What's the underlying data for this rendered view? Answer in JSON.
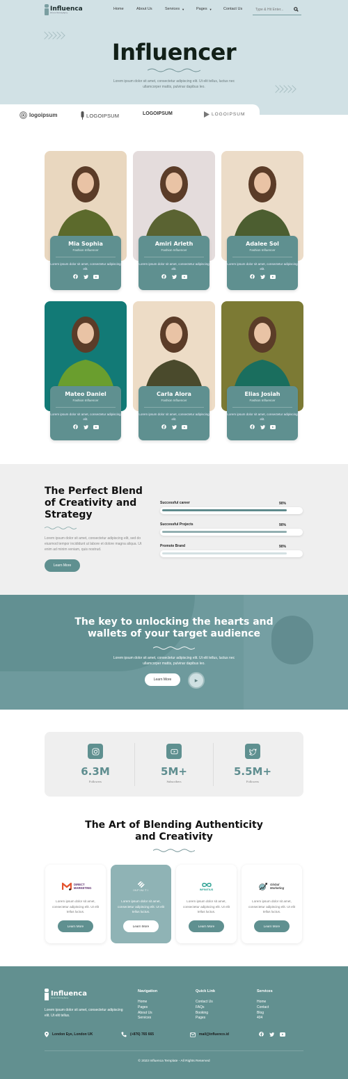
{
  "nav": {
    "logo_text": "Influenca",
    "logo_subtitle": "Influencer Marketing Agency",
    "items": [
      {
        "label": "Home",
        "has_dropdown": false
      },
      {
        "label": "About Us",
        "has_dropdown": false
      },
      {
        "label": "Services",
        "has_dropdown": true
      },
      {
        "label": "Pages",
        "has_dropdown": true
      },
      {
        "label": "Contact Us",
        "has_dropdown": false
      }
    ],
    "search_placeholder": "Type & Hit Enter...",
    "search_icon": "search-icon"
  },
  "hero": {
    "title": "Influencer",
    "description": "Lorem ipsum dolor sit amet, consectetur adipiscing elit. Ut elit tellus, luctus nec ullamcorper mattis, pulvinar dapibus leo."
  },
  "partner_logos": [
    "logoipsum",
    "LOGOIPSUM",
    "LOGOIPSUM",
    "LOGOIPSUM"
  ],
  "influencers": [
    {
      "name": "Mia Sophia",
      "role": "Fashion Influencer",
      "desc": "Lorem ipsum dolor sit amet, consectetur adipiscing elit.",
      "photo_colors": [
        "#e9d7bf",
        "#5c6a2c"
      ]
    },
    {
      "name": "Amiri Arleth",
      "role": "Fashion Influencer",
      "desc": "Lorem ipsum dolor sit amet, consectetur adipiscing elit.",
      "photo_colors": [
        "#e4dcdc",
        "#5a6332"
      ]
    },
    {
      "name": "Adalee Sol",
      "role": "Fashion Influencer",
      "desc": "Lorem ipsum dolor sit amet, consectetur adipiscing elit.",
      "photo_colors": [
        "#ecdcc8",
        "#4c5e30"
      ]
    },
    {
      "name": "Mateo Daniel",
      "role": "Fashion Influencer",
      "desc": "Lorem ipsum dolor sit amet, consectetur adipiscing elit.",
      "photo_colors": [
        "#127a76",
        "#6a9e2e"
      ]
    },
    {
      "name": "Carla Alora",
      "role": "Fashion Influencer",
      "desc": "Lorem ipsum dolor sit amet, consectetur adipiscing elit.",
      "photo_colors": [
        "#eddcc6",
        "#4a4a2c"
      ]
    },
    {
      "name": "Elias Josiah",
      "role": "Fashion Influencer",
      "desc": "Lorem ipsum dolor sit amet, consectetur adipiscing elit.",
      "photo_colors": [
        "#7c7a34",
        "#1a6e5e"
      ]
    }
  ],
  "blend": {
    "title": "The Perfect Blend of Creativity and Strategy",
    "description": "Lorem ipsum dolor sit amet, consectetur adipiscing elit, sed do eiusmod tempor incididunt ut labore et dolore magna aliqua. Ut enim ad minim veniam, quis nostrud.",
    "button": "Learn More",
    "skills": [
      {
        "label": "Successful career",
        "value": 90,
        "value_label": "90%",
        "color": "#5f8a8c"
      },
      {
        "label": "Successful Projects",
        "value": 90,
        "value_label": "90%",
        "color": "#92afb1"
      },
      {
        "label": "Promote Brand",
        "value": 90,
        "value_label": "90%",
        "color": "#d3e0e2"
      }
    ]
  },
  "cta": {
    "title": "The key to unlocking the hearts and wallets of your target audience",
    "description": "Lorem ipsum dolor sit amet, consectetur adipiscing elit. Ut elit tellus, luctus nec ullamcorper mattis, pulvinar dapibus leo.",
    "button": "Learn More",
    "play_icon": "play-icon"
  },
  "stats": [
    {
      "icon": "instagram-icon",
      "value": "6.3M",
      "label": "Followers"
    },
    {
      "icon": "youtube-icon",
      "value": "5M+",
      "label": "Subscribers"
    },
    {
      "icon": "twitter-icon",
      "value": "5.5M+",
      "label": "Followers"
    }
  ],
  "art": {
    "title": "The Art of Blending Authenticity and Creativity",
    "partners": [
      {
        "logo": "DIRECT MARKETING",
        "desc": "Lorem ipsum dolor sit amet, consectetur adipiscing elit. Ut elit tellus luctus.",
        "button": "Learn More",
        "active": false
      },
      {
        "logo": "INFINITI",
        "desc": "Lorem ipsum dolor sit amet, consectetur adipiscing elit. Ut elit tellus luctus.",
        "button": "Learn More",
        "active": true
      },
      {
        "logo": "INFINITIUS",
        "desc": "Lorem ipsum dolor sit amet, consectetur adipiscing elit. Ut elit tellus luctus.",
        "button": "Learn More",
        "active": false
      },
      {
        "logo": "Global Marketing",
        "desc": "Lorem ipsum dolor sit amet, consectetur adipiscing elit. Ut elit tellus luctus.",
        "button": "Learn More",
        "active": false
      }
    ]
  },
  "footer": {
    "logo_text": "Influenca",
    "description": "Lorem ipsum dolor sit amet, consectetur adipiscing elit. Ut elit tellus.",
    "columns": [
      {
        "heading": "Navigation",
        "links": [
          "Home",
          "Pages",
          "About Us",
          "Services"
        ]
      },
      {
        "heading": "Quick Link",
        "links": [
          "Contact Us",
          "FAQs",
          "Booking",
          "Pages"
        ]
      },
      {
        "heading": "Services",
        "links": [
          "Home",
          "Contact",
          "Blog",
          "404"
        ]
      }
    ],
    "address": "London Eye, London UK",
    "phone": "(+876) 765 665",
    "email": "mail@influenco.id",
    "copyright": "© 2023 Influenca Template - All Rights Reserved"
  },
  "colors": {
    "accent": "#5f9090",
    "hero_bg": "#d1e1e5",
    "footer_bg": "#629090",
    "light_bg": "#efefef"
  }
}
